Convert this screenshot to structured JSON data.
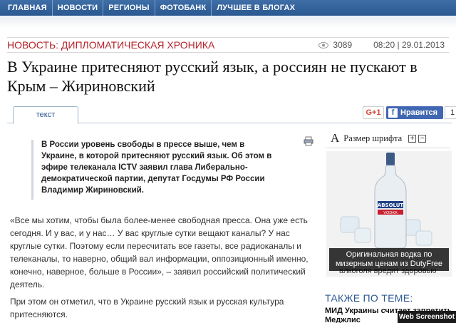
{
  "nav": {
    "items": [
      "ГЛАВНАЯ",
      "НОВОСТИ",
      "РЕГИОНЫ",
      "ФОТОБАНК",
      "ЛУЧШЕЕ В БЛОГАХ"
    ]
  },
  "article": {
    "category": "НОВОСТЬ: ДИПЛОМАТИЧЕСКАЯ ХРОНИКА",
    "views": "3089",
    "datetime": "08:20 | 29.01.2013",
    "title": "В Украине притесняют русский язык, а россиян не пускают в Крым – Жириновский",
    "tab_label": "текст",
    "lead": "В России уровень свободы в прессе выше, чем в Украине, в которой притесняют русский язык. Об этом в эфире телеканала ICTV заявил глава Либерально-демократической партии, депутат Госдумы РФ России Владимир Жириновский.",
    "paragraph1": "«Все мы хотим, чтобы была более-менее свободная пресса. Она уже есть сегодня. И у вас, и у нас… У вас круглые сутки вещают каналы? У нас круглые сутки. Поэтому если пересчитать все газеты, все радиоканалы и телеканалы, то наверно, общий вал информации, оппозиционный именно, конечно, наверное, больше в России», – заявил российский политический деятель.",
    "paragraph2": "При этом он отметил, что в Украине русский язык и русская культура притесняются."
  },
  "share": {
    "gplus_label": "G+1",
    "fb_icon": "f",
    "fb_label": "Нравится",
    "fb_count": "1"
  },
  "sidebar": {
    "font_a": "A",
    "font_label": "Размер шрифта",
    "plus": "+",
    "minus": "−",
    "ad_caption": "Оригинальная водка по мизерным ценам из DutyFree",
    "ad_behind": "алкоголя вредит здоровью",
    "bottle_brand": "ABSOLUT",
    "bottle_type": "VODKA",
    "related_title": "ТАКЖЕ ПО ТЕМЕ:",
    "related_item": "МИД Украины считает запретить Меджлис"
  },
  "watermark": "Web Screenshot",
  "colors": {
    "nav_bg": "#2a5790",
    "category": "#b4232b",
    "facebook": "#4267b2",
    "link": "#2a5790"
  }
}
